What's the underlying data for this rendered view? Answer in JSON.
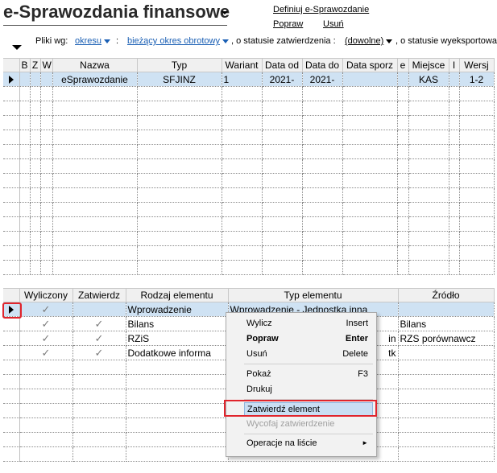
{
  "header": {
    "title": "e-Sprawozdania finansowe",
    "define_link": "Definiuj e-Sprawozdanie",
    "edit_link": "Popraw",
    "delete_link": "Usuń"
  },
  "filter": {
    "label": "Pliki wg:",
    "field": "okresu",
    "sep": ":",
    "period": "bieżący okres obrotowy",
    "status_label": ", o statusie zatwierdzenia :",
    "status_value": "(dowolne)",
    "export_label": ", o statusie wyeksportowa"
  },
  "top_grid": {
    "columns": [
      "B",
      "Z",
      "W",
      "Nazwa",
      "Typ",
      "Wariant",
      "Data od",
      "Data do",
      "Data sporz",
      "e",
      "Miejsce",
      "I",
      "Wersj"
    ],
    "rows": [
      {
        "B": "",
        "Z": "",
        "W": "",
        "Nazwa": "eSprawozdanie",
        "Typ": "SFJINZ",
        "Wariant": "1",
        "Data_od": "2021-",
        "Data_do": "2021-",
        "Data_sporz": "",
        "e": "",
        "Miejsce": "KAS",
        "I": "",
        "Wersj": "1-2"
      }
    ]
  },
  "bottom_grid": {
    "columns": [
      "Wyliczony",
      "Zatwierdz",
      "Rodzaj elementu",
      "Typ elementu",
      "Źródło"
    ],
    "rows": [
      {
        "wyliczony": true,
        "zatwierdz": false,
        "rodzaj": "Wprowadzenie",
        "typ": "Wprowadzenie - Jednostka inna",
        "zrodlo": ""
      },
      {
        "wyliczony": true,
        "zatwierdz": true,
        "rodzaj": "Bilans",
        "typ": "",
        "zrodlo": "Bilans"
      },
      {
        "wyliczony": true,
        "zatwierdz": true,
        "rodzaj": "RZiS",
        "typ": "in",
        "zrodlo": "RZS porównawcz"
      },
      {
        "wyliczony": true,
        "zatwierdz": true,
        "rodzaj": "Dodatkowe informa",
        "typ": "tk",
        "zrodlo": ""
      }
    ]
  },
  "context_menu": {
    "items": [
      {
        "label": "Wylicz",
        "shortcut": "Insert"
      },
      {
        "label": "Popraw",
        "shortcut": "Enter"
      },
      {
        "label": "Usuń",
        "shortcut": "Delete"
      },
      {
        "label": "Pokaż",
        "shortcut": "F3"
      },
      {
        "label": "Drukuj",
        "shortcut": ""
      },
      {
        "label": "Zatwierdź element",
        "shortcut": ""
      },
      {
        "label": "Wycofaj zatwierdzenie",
        "shortcut": ""
      },
      {
        "label": "Operacje na liście",
        "shortcut": ""
      }
    ]
  },
  "icons": {
    "check": "✓",
    "submenu_arrow": "►"
  },
  "colors": {
    "selection": "#cfe2f3",
    "highlight": "#e0242c",
    "link": "#1a5fb4"
  }
}
